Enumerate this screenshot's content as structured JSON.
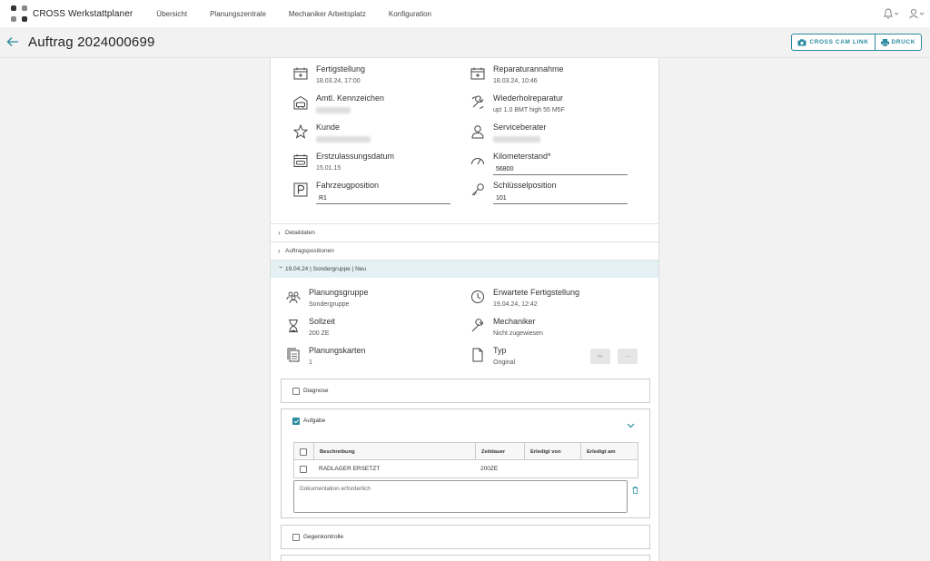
{
  "app": {
    "brand": "CROSS Werkstattplaner"
  },
  "nav": {
    "links": [
      "Übersicht",
      "Planungszentrale",
      "Mechaniker Arbeitsplatz",
      "Konfiguration"
    ]
  },
  "colors": {
    "accent": "#2a8a9e",
    "active_section_bg": "#e3f1f4"
  },
  "header": {
    "title": "Auftrag 2024000699",
    "cam_link_label": "CROSS CAM LINK",
    "print_label": "DRUCK"
  },
  "order": {
    "fertigstellung": {
      "label": "Fertigstellung",
      "value": "18.03.24, 17:00"
    },
    "reparaturannahme": {
      "label": "Reparaturannahme",
      "value": "18.03.24, 10:46"
    },
    "kennzeichen": {
      "label": "Amtl. Kennzeichen"
    },
    "wiederholreparatur": {
      "label": "Wiederholreparatur",
      "value": "up! 1.0 BMT high 55 M5F"
    },
    "kunde": {
      "label": "Kunde"
    },
    "serviceberater": {
      "label": "Serviceberater"
    },
    "erstzulassung": {
      "label": "Erstzulassungsdatum",
      "value": "15.01.15"
    },
    "kilometerstand": {
      "label": "Kilometerstand*",
      "value": "56800"
    },
    "fahrzeugposition": {
      "label": "Fahrzeugposition",
      "value": "R1"
    },
    "schluesselposition": {
      "label": "Schlüsselposition",
      "value": "101"
    }
  },
  "sections": {
    "detaildaten": "Detaildaten",
    "auftragspositionen": "Auftragspositionen",
    "group": "19.04.24 | Sondergruppe | Neu"
  },
  "group": {
    "planungsgruppe": {
      "label": "Planungsgruppe",
      "value": "Sondergruppe"
    },
    "erwartete": {
      "label": "Erwartete Fertigstellung",
      "value": "19.04.24, 12:42"
    },
    "sollzeit": {
      "label": "Sollzeit",
      "value": "200 ZE"
    },
    "mechaniker": {
      "label": "Mechaniker",
      "value": "Nicht zugewiesen"
    },
    "planungskarten": {
      "label": "Planungskarten",
      "value": "1"
    },
    "typ": {
      "label": "Typ",
      "value": "Original"
    }
  },
  "checklist": {
    "diagnose": {
      "label": "Diagnose",
      "checked": false
    },
    "aufgabe": {
      "label": "Aufgabe",
      "checked": true
    },
    "gegenkontrolle": {
      "label": "Gegenkontrolle",
      "checked": false
    }
  },
  "task_table": {
    "headers": [
      "Beschreibung",
      "Zeitdauer",
      "Erledigt von",
      "Erledigt am"
    ],
    "rows": [
      {
        "beschreibung": "RADLAGER ERSETZT",
        "zeitdauer": "200ZE",
        "erledigt_von": "",
        "erledigt_am": ""
      }
    ]
  },
  "documentation": {
    "placeholder": "Dokumentation erforderlich"
  }
}
